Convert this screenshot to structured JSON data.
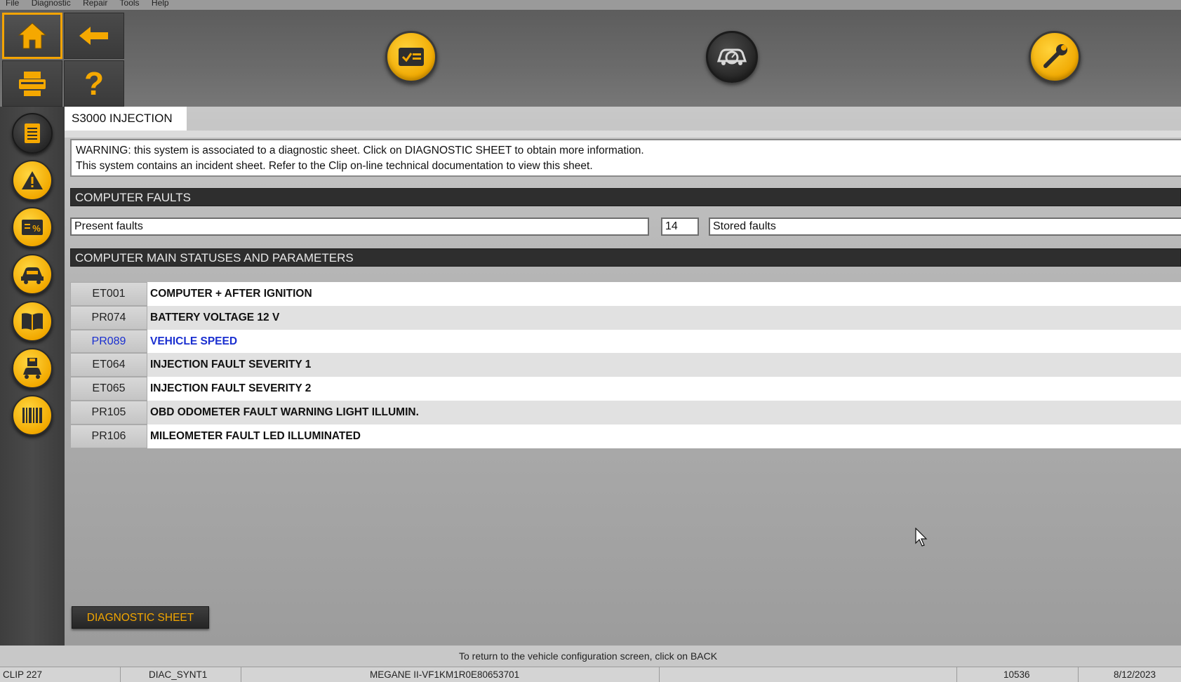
{
  "menu": [
    "File",
    "Diagnostic",
    "Repair",
    "Tools",
    "Help"
  ],
  "toolbar": {
    "buttons": [
      "home-icon",
      "back-arrow-icon",
      "printer-icon",
      "help-icon"
    ],
    "round_buttons": [
      "diagnostic-check-icon",
      "vehicle-gauge-icon",
      "wrench-icon"
    ]
  },
  "sidebar": {
    "icons": [
      "document-list-icon",
      "warning-icon",
      "parameters-icon",
      "vehicle-config-icon",
      "manual-book-icon",
      "vehicle-save-icon",
      "barcode-icon"
    ]
  },
  "tab": {
    "title": "S3000 INJECTION"
  },
  "warning": {
    "line1": "WARNING: this system is associated to a diagnostic sheet. Click on DIAGNOSTIC SHEET to obtain more information.",
    "line2": "This system contains an incident sheet. Refer to the Clip on-line technical documentation to view this sheet."
  },
  "faults": {
    "header": "COMPUTER FAULTS",
    "present_label": "Present faults",
    "count": "14",
    "stored_label": "Stored faults"
  },
  "params": {
    "header": "COMPUTER MAIN STATUSES AND PARAMETERS",
    "rows": [
      {
        "code": "ET001",
        "desc": "COMPUTER + AFTER IGNITION"
      },
      {
        "code": "PR074",
        "desc": "BATTERY VOLTAGE 12 V"
      },
      {
        "code": "PR089",
        "desc": "VEHICLE SPEED"
      },
      {
        "code": "ET064",
        "desc": "INJECTION FAULT SEVERITY 1"
      },
      {
        "code": "ET065",
        "desc": "INJECTION FAULT SEVERITY 2"
      },
      {
        "code": "PR105",
        "desc": "OBD ODOMETER FAULT WARNING LIGHT ILLUMIN."
      },
      {
        "code": "PR106",
        "desc": "MILEOMETER FAULT LED ILLUMINATED"
      }
    ]
  },
  "diagnostic_sheet_label": "DIAGNOSTIC SHEET",
  "message": "To return to the vehicle configuration screen, click on BACK",
  "status": {
    "clip": "CLIP 227",
    "module": "DIAC_SYNT1",
    "vehicle": "MEGANE II-VF1KM1R0E80653701",
    "code": "10536",
    "date": "8/12/2023"
  },
  "colors": {
    "accent": "#f2a900",
    "selected_text": "#1a2fd0",
    "header_bg": "#2e2e2e"
  }
}
